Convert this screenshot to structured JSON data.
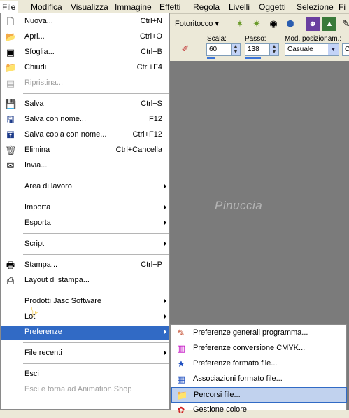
{
  "menubar": {
    "items": [
      "File",
      "Modifica",
      "Visualizza",
      "Immagine",
      "Effetti",
      "Regola",
      "Livelli",
      "Oggetti",
      "Selezione",
      "Fi"
    ]
  },
  "toolbar": {
    "photo_retouch_label": "Fotoritocco",
    "scala_label": "Scala:",
    "scala_value": "60",
    "passo_label": "Passo:",
    "passo_value": "138",
    "mod_label": "Mod. posizionam.:",
    "mod_value": "Casuale",
    "extra_value": "C"
  },
  "canvas": {
    "watermark": "Pinuccia"
  },
  "file_menu": {
    "items": [
      {
        "label": "Nuova...",
        "shortcut": "Ctrl+N",
        "icon": "new-document-icon"
      },
      {
        "label": "Apri...",
        "shortcut": "Ctrl+O",
        "icon": "open-folder-icon"
      },
      {
        "label": "Sfoglia...",
        "shortcut": "Ctrl+B",
        "icon": "browse-icon"
      },
      {
        "label": "Chiudi",
        "shortcut": "Ctrl+F4",
        "icon": "close-folder-icon"
      },
      {
        "label": "Ripristina...",
        "shortcut": "",
        "icon": "revert-icon",
        "disabled": true
      },
      {
        "label": "Salva",
        "shortcut": "Ctrl+S",
        "icon": "save-icon"
      },
      {
        "label": "Salva con nome...",
        "shortcut": "F12",
        "icon": "save-as-icon"
      },
      {
        "label": "Salva copia con nome...",
        "shortcut": "Ctrl+F12",
        "icon": "save-copy-icon"
      },
      {
        "label": "Elimina",
        "shortcut": "Ctrl+Cancella",
        "icon": "trash-icon"
      },
      {
        "label": "Invia...",
        "shortcut": "",
        "icon": "send-icon"
      },
      {
        "label": "Area di lavoro",
        "shortcut": "",
        "submenu": true
      },
      {
        "label": "Importa",
        "shortcut": "",
        "submenu": true
      },
      {
        "label": "Esporta",
        "shortcut": "",
        "submenu": true
      },
      {
        "label": "Script",
        "shortcut": "",
        "submenu": true
      },
      {
        "label": "Stampa...",
        "shortcut": "Ctrl+P",
        "icon": "print-icon"
      },
      {
        "label": "Layout di stampa...",
        "shortcut": "",
        "icon": "print-layout-icon"
      },
      {
        "label": "Prodotti Jasc Software",
        "shortcut": "",
        "submenu": true
      },
      {
        "label": "Lot",
        "shortcut": "",
        "submenu": true
      },
      {
        "label": "Preferenze",
        "shortcut": "",
        "submenu": true,
        "highlighted": true
      },
      {
        "label": "File recenti",
        "shortcut": "",
        "submenu": true
      },
      {
        "label": "Esci",
        "shortcut": ""
      },
      {
        "label": "Esci e torna ad Animation Shop",
        "shortcut": "",
        "disabled": true
      }
    ]
  },
  "preferences_submenu": {
    "items": [
      {
        "label": "Preferenze generali programma...",
        "icon": "general-preferences-icon"
      },
      {
        "label": "Preferenze conversione CMYK...",
        "icon": "cmyk-icon"
      },
      {
        "label": "Preferenze formato file...",
        "icon": "file-format-icon"
      },
      {
        "label": "Associazioni formato file...",
        "icon": "file-association-icon"
      },
      {
        "label": "Percorsi file...",
        "icon": "file-paths-icon",
        "selected": true
      },
      {
        "label": "Gestione colore",
        "icon": "color-management-icon"
      }
    ]
  }
}
